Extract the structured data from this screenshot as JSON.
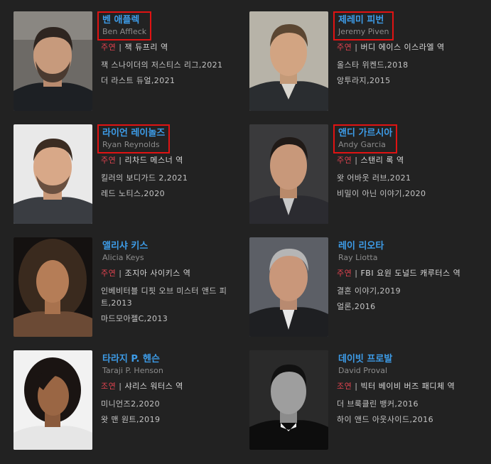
{
  "cast": [
    {
      "name": "벤 애플렉",
      "english_name": "Ben Affleck",
      "role_type": "주연",
      "role": "잭 듀프리 역",
      "highlighted": true,
      "works": [
        "잭 스나이더의 저스티스 리그,2021",
        "더 라스트 듀얼,2021"
      ]
    },
    {
      "name": "제레미 피번",
      "english_name": "Jeremy Piven",
      "role_type": "주연",
      "role": "버디 에이스 이스라엘 역",
      "highlighted": true,
      "works": [
        "올스타 위켄드,2018",
        "앙투라지,2015"
      ]
    },
    {
      "name": "라이언 레이놀즈",
      "english_name": "Ryan Reynolds",
      "role_type": "주연",
      "role": "리차드 메스너 역",
      "highlighted": true,
      "works": [
        "킬러의 보디가드 2,2021",
        "레드 노티스,2020"
      ]
    },
    {
      "name": "앤디 가르시아",
      "english_name": "Andy Garcia",
      "role_type": "주연",
      "role": "스탠리 록 역",
      "highlighted": true,
      "works": [
        "왓 어바웃 러브,2021",
        "비밀이 아닌 이야기,2020"
      ]
    },
    {
      "name": "앨리샤 키스",
      "english_name": "Alicia Keys",
      "role_type": "주연",
      "role": "조지아 사이키스 역",
      "highlighted": false,
      "works": [
        "인베비터블 디핏 오브 미스터 앤드 피트,2013",
        "마드모아젤C,2013"
      ]
    },
    {
      "name": "레이 리오타",
      "english_name": "Ray Liotta",
      "role_type": "주연",
      "role": "FBI 요원 도널드 캐루터스 역",
      "highlighted": false,
      "works": [
        "결혼 이야기,2019",
        "얼론,2016"
      ]
    },
    {
      "name": "타라지 P. 헨슨",
      "english_name": "Taraji P. Henson",
      "role_type": "조연",
      "role": "샤리스 워터스 역",
      "highlighted": false,
      "works": [
        "미니언즈2,2020",
        "왓 맨 원트,2019"
      ]
    },
    {
      "name": "데이빗 프로발",
      "english_name": "David Proval",
      "role_type": "조연",
      "role": "빅터 베이비 버즈 패디체 역",
      "highlighted": false,
      "works": [
        "더 브룩클린 뱅커,2016",
        "하이 앤드 아웃사이드,2016"
      ]
    }
  ],
  "colors": {
    "background": "#222222",
    "name_link": "#3d9ce8",
    "role_type": "#e0434f",
    "highlight_box": "#e01313"
  }
}
